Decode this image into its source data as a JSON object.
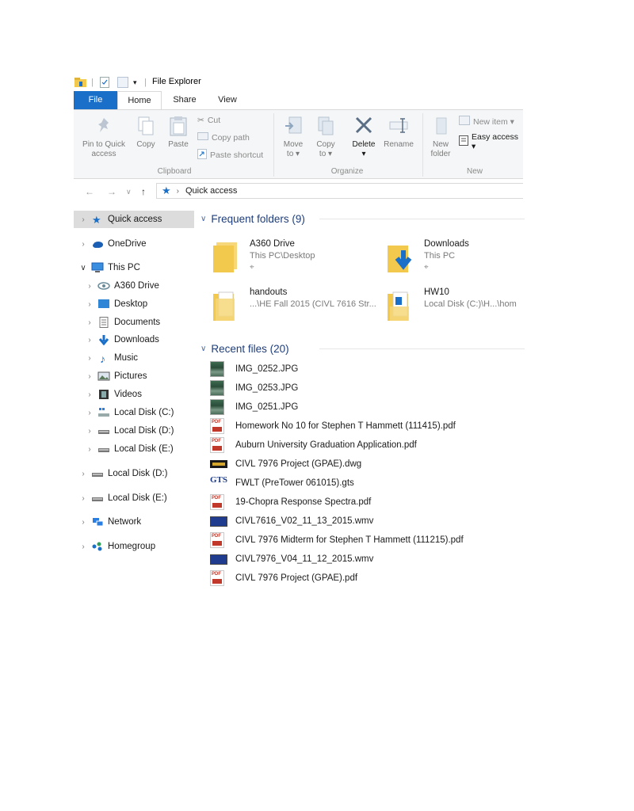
{
  "window": {
    "title": "File Explorer"
  },
  "tabs": {
    "file": "File",
    "home": "Home",
    "share": "Share",
    "view": "View"
  },
  "ribbon": {
    "clipboard": {
      "pin": [
        "Pin to Quick",
        "access"
      ],
      "copy": "Copy",
      "paste": "Paste",
      "cut": "Cut",
      "copy_path": "Copy path",
      "paste_shortcut": "Paste shortcut",
      "label": "Clipboard"
    },
    "organize": {
      "move_to": [
        "Move",
        "to ▾"
      ],
      "copy_to": [
        "Copy",
        "to ▾"
      ],
      "delete": [
        "Delete",
        "▾"
      ],
      "rename": "Rename",
      "label": "Organize"
    },
    "new": {
      "new_folder": [
        "New",
        "folder"
      ],
      "new_item": "New item ▾",
      "easy_access": "Easy access ▾",
      "label": "New"
    }
  },
  "address": {
    "location": "Quick access"
  },
  "nav": {
    "quick_access": "Quick access",
    "onedrive": "OneDrive",
    "this_pc": "This PC",
    "a360": "A360 Drive",
    "desktop": "Desktop",
    "documents": "Documents",
    "downloads": "Downloads",
    "music": "Music",
    "pictures": "Pictures",
    "videos": "Videos",
    "local_c": "Local Disk (C:)",
    "local_d": "Local Disk (D:)",
    "local_e": "Local Disk (E:)",
    "local_d2": "Local Disk (D:)",
    "local_e2": "Local Disk (E:)",
    "network": "Network",
    "homegroup": "Homegroup"
  },
  "frequent": {
    "heading": "Frequent folders (9)",
    "folders": [
      {
        "name": "A360 Drive",
        "path": "This PC\\Desktop"
      },
      {
        "name": "Downloads",
        "path": "This PC"
      },
      {
        "name": "handouts",
        "path": "...\\HE Fall 2015 (CIVL 7616 Str..."
      },
      {
        "name": "HW10",
        "path": "Local Disk (C:)\\H...\\hom"
      }
    ]
  },
  "recent": {
    "heading": "Recent files (20)",
    "files": [
      {
        "name": "IMG_0252.JPG",
        "type": "image"
      },
      {
        "name": "IMG_0253.JPG",
        "type": "image"
      },
      {
        "name": "IMG_0251.JPG",
        "type": "image"
      },
      {
        "name": "Homework No 10 for Stephen T Hammett (111415).pdf",
        "type": "pdf"
      },
      {
        "name": "Auburn University Graduation Application.pdf",
        "type": "pdf"
      },
      {
        "name": "CIVL 7976 Project (GPAE).dwg",
        "type": "dwg"
      },
      {
        "name": "FWLT (PreTower 061015).gts",
        "type": "gts"
      },
      {
        "name": "19-Chopra Response Spectra.pdf",
        "type": "pdf"
      },
      {
        "name": "CIVL7616_V02_11_13_2015.wmv",
        "type": "wmv"
      },
      {
        "name": "CIVL 7976 Midterm for Stephen T Hammett (111215).pdf",
        "type": "pdf"
      },
      {
        "name": "CIVL7976_V04_11_12_2015.wmv",
        "type": "wmv"
      },
      {
        "name": "CIVL 7976 Project (GPAE).pdf",
        "type": "pdf"
      }
    ]
  },
  "colors": {
    "accent": "#1a6fc9",
    "folder": "#f2c94c",
    "heading": "#1e3d7b"
  }
}
